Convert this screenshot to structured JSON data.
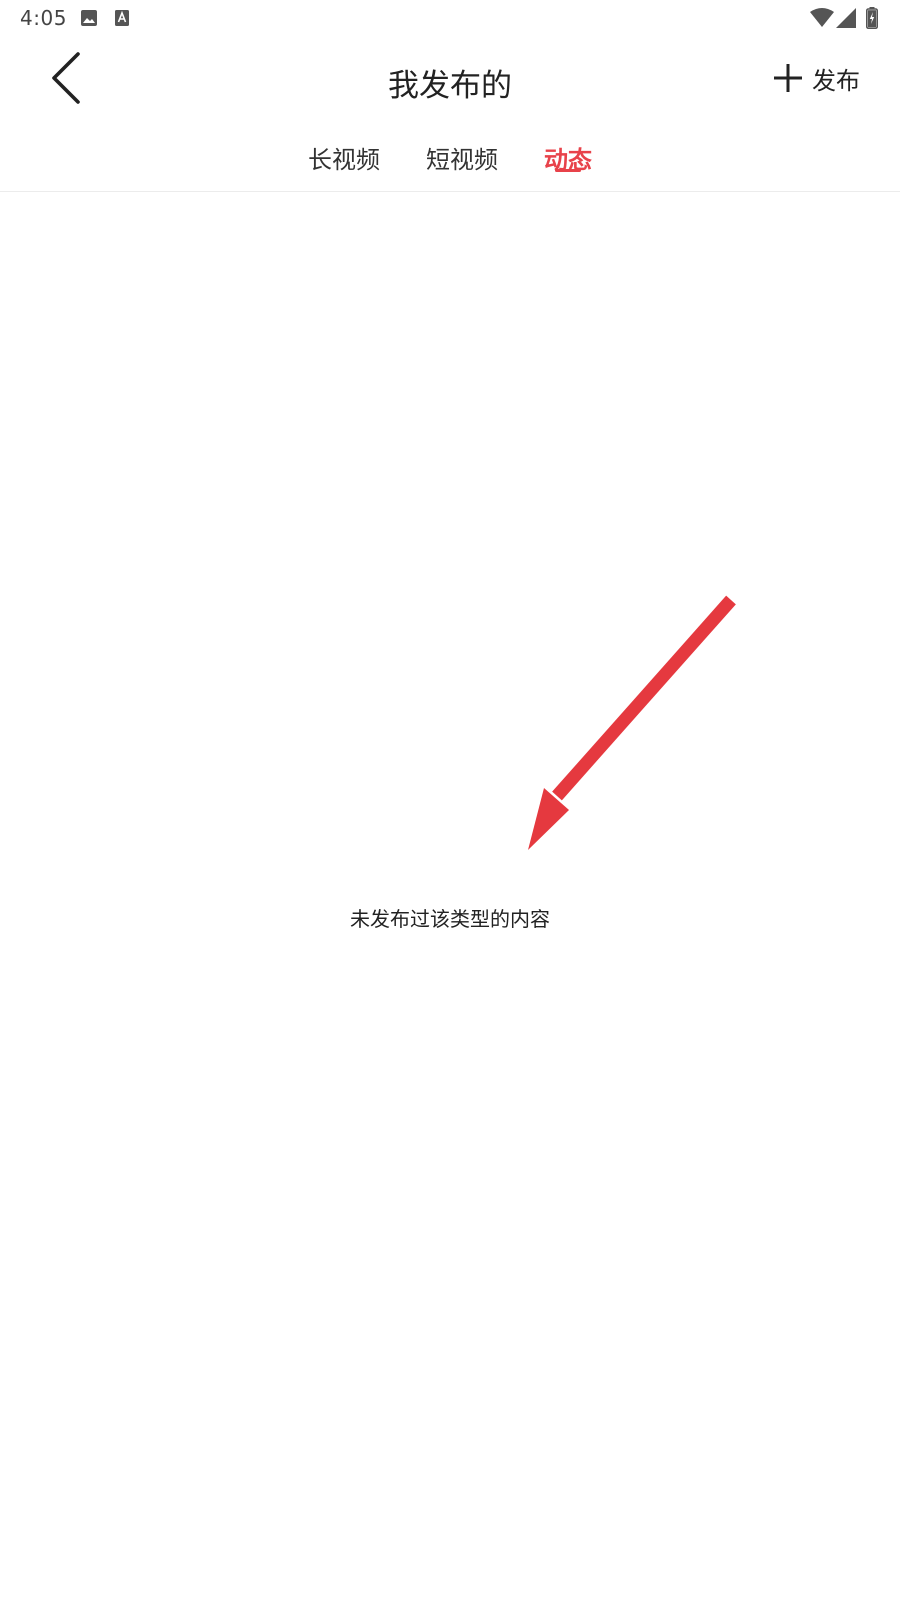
{
  "status_bar": {
    "time": "4:05",
    "left_icons": [
      "image-icon",
      "a-letter-icon"
    ],
    "right_icons": [
      "wifi-icon",
      "signal-icon",
      "battery-charging-icon"
    ]
  },
  "header": {
    "back_icon": "chevron-left-icon",
    "title": "我发布的",
    "publish_icon": "plus-icon",
    "publish_label": "发布"
  },
  "tabs": [
    {
      "label": "长视频",
      "active": false
    },
    {
      "label": "短视频",
      "active": false
    },
    {
      "label": "动态",
      "active": true
    }
  ],
  "empty_state": {
    "message": "未发布过该类型的内容"
  },
  "colors": {
    "accent": "#e8424a",
    "annotation_arrow": "#e5393f",
    "text": "#222222",
    "divider": "#ececec"
  }
}
